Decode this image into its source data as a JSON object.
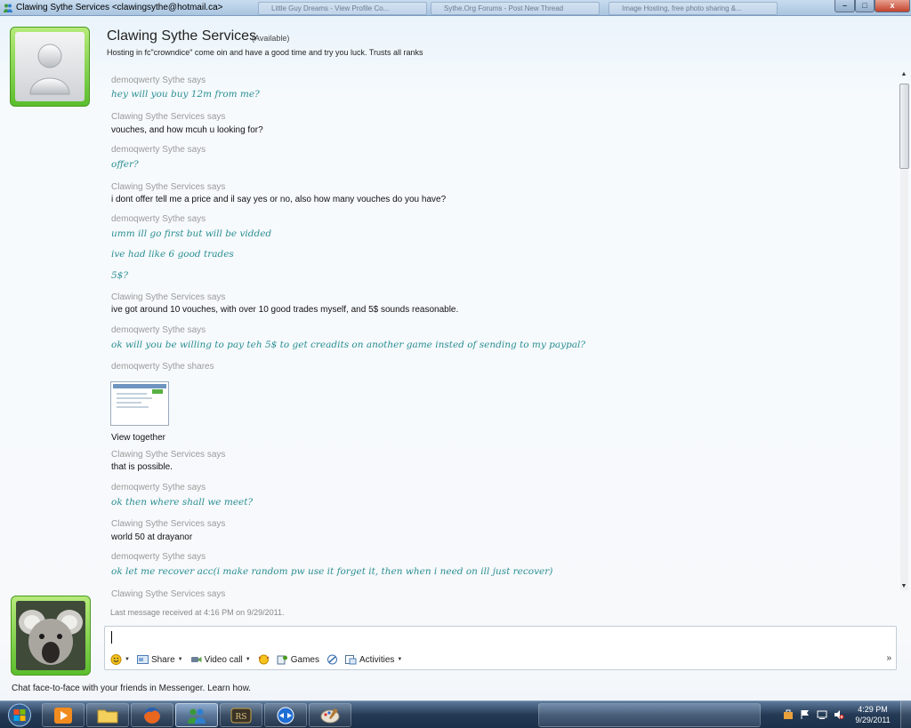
{
  "window": {
    "title": "Clawing Sythe Services <clawingsythe@hotmail.ca>",
    "background_tabs": [
      "Little Guy Dreams - View Profile Co...",
      "Sythe.Org Forums - Post New Thread",
      "Image Hosting, free photo sharing &..."
    ],
    "minimize_label": "–",
    "maximize_label": "□",
    "close_label": "x"
  },
  "contact": {
    "name": "Clawing Sythe Services",
    "status": "(Available)",
    "personal_message": "Hosting in fc\"crowndice\" come oin and have a good time and try you luck. Trusts all ranks"
  },
  "conversation": [
    {
      "sender": "demoqwerty Sythe says",
      "style": "mine",
      "lines": [
        "hey will you buy 12m from me?"
      ]
    },
    {
      "sender": "Clawing Sythe Services says",
      "style": "theirs",
      "lines": [
        "vouches, and how mcuh u looking for?"
      ]
    },
    {
      "sender": "demoqwerty Sythe says",
      "style": "mine",
      "lines": [
        "offer?"
      ]
    },
    {
      "sender": "Clawing Sythe Services says",
      "style": "theirs",
      "lines": [
        "i dont offer tell me a price and il say yes or no, also how many vouches do you have?"
      ]
    },
    {
      "sender": "demoqwerty Sythe says",
      "style": "mine",
      "lines": [
        "umm ill go first but will be vidded",
        "ive had like 6 good trades",
        "5$?"
      ]
    },
    {
      "sender": "Clawing Sythe Services says",
      "style": "theirs",
      "lines": [
        "ive got around 10 vouches, with over 10 good trades myself, and 5$ sounds reasonable."
      ]
    },
    {
      "sender": "demoqwerty Sythe says",
      "style": "mine",
      "lines": [
        "ok will you be willing to pay teh 5$ to get creadits on another game insted of sending to my paypal?"
      ]
    },
    {
      "sender": "demoqwerty Sythe shares",
      "style": "share",
      "lines": [
        "View together"
      ]
    },
    {
      "sender": "Clawing Sythe Services says",
      "style": "theirs",
      "lines": [
        "that is possible."
      ]
    },
    {
      "sender": "demoqwerty Sythe says",
      "style": "mine",
      "lines": [
        "ok then where shall we meet?"
      ]
    },
    {
      "sender": "Clawing Sythe Services says",
      "style": "theirs",
      "lines": [
        "world 50 at  drayanor"
      ]
    },
    {
      "sender": "demoqwerty Sythe says",
      "style": "mine",
      "lines": [
        "ok let me recover acc(i make random pw use it forget it, then when i need on ill just recover)"
      ]
    },
    {
      "sender": "Clawing Sythe Services says",
      "style": "theirs",
      "lines": []
    }
  ],
  "last_received": "Last message received at 4:16 PM on 9/29/2011.",
  "toolbar": {
    "share_label": "Share",
    "video_call_label": "Video call",
    "games_label": "Games",
    "activities_label": "Activities",
    "more_label": "»"
  },
  "footer_tip": "Chat face-to-face with your friends in Messenger. Learn how.",
  "taskbar": {
    "clock_time": "4:29 PM",
    "clock_date": "9/29/2011",
    "apps": [
      "windows-media-player",
      "windows-explorer",
      "firefox",
      "windows-live-messenger",
      "runescape",
      "teamviewer",
      "paint"
    ]
  },
  "colors": {
    "my_message_text": "#2b8e93",
    "avatar_frame_green": "#5bbe2d",
    "sender_gray": "#9a9a9a"
  }
}
